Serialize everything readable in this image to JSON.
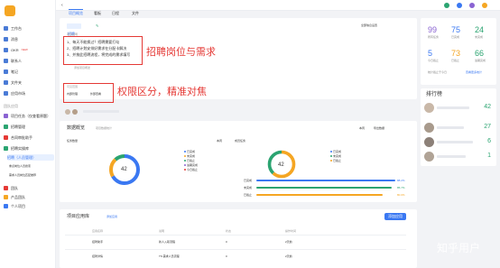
{
  "sidebar": {
    "items": [
      {
        "label": "工作台"
      },
      {
        "label": "消息"
      },
      {
        "label": "OKR",
        "badge": "NEW"
      },
      {
        "label": "联系人"
      },
      {
        "label": "笔记"
      },
      {
        "label": "文件夹"
      },
      {
        "label": "应用市场"
      }
    ],
    "section_label": "团队应用",
    "team_items": [
      {
        "label": "项目任务（仅查看原题）"
      },
      {
        "label": "招聘管理"
      },
      {
        "label": "合同审批助手"
      },
      {
        "label": "招聘实操库"
      }
    ],
    "sub_items": [
      {
        "label": "招聘（人员管理）"
      },
      {
        "label": "重点岗位人员搜索"
      },
      {
        "label": "需求人员岗位匹配推荐"
      }
    ],
    "bottom_items": [
      {
        "label": "团队"
      },
      {
        "label": "产品团队"
      },
      {
        "label": "个人项目"
      }
    ]
  },
  "topbar": {
    "tabs": [
      {
        "label": "项目概览"
      },
      {
        "label": "看板"
      },
      {
        "label": "日程"
      },
      {
        "label": "文件"
      }
    ],
    "icon_colors": [
      "#2ba471",
      "#3a78f2",
      "#8a63d2",
      "#f5a623"
    ]
  },
  "project": {
    "name": "招聘",
    "desc_header": "项目说明",
    "desc_lines": [
      "1、每天不能换过？招聘需要打勾",
      "2、招聘计划安排好需求在分配卡解决",
      "3、并按此招聘流程，将完成的需求填写"
    ],
    "extra_link": "添加项目概述",
    "link_label": "全部信息设置",
    "visibility_header": "可见范围",
    "visibility_options": [
      "内部",
      "外部"
    ],
    "visibility_values": [
      "内部管理",
      "外部查看"
    ]
  },
  "annotations": {
    "requirements": "招聘岗位与需求",
    "permissions": "权限区分，精准对焦"
  },
  "stats": [
    {
      "value": "99",
      "label": "所有任务",
      "color": "#8a63d2"
    },
    {
      "value": "75",
      "label": "已完成",
      "color": "#3a78f2"
    },
    {
      "value": "24",
      "label": "未完成",
      "color": "#2ba471"
    },
    {
      "value": "5",
      "label": "今日截止",
      "color": "#3a78f2"
    },
    {
      "value": "73",
      "label": "已截止",
      "color": "#f5a623"
    },
    {
      "value": "66",
      "label": "逾期完成",
      "color": "#2ba471"
    }
  ],
  "stats_note": "统计截止于今日",
  "stats_link": "查看更多统计",
  "ranking": {
    "title": "排行榜",
    "rows": [
      {
        "value": "42"
      },
      {
        "value": "27"
      },
      {
        "value": "6"
      },
      {
        "value": "1"
      }
    ]
  },
  "data_overview": {
    "title": "数据概览",
    "subtitle": "项目数据统计",
    "filter_label": "本周",
    "export_label": "导出数据",
    "left_chart": {
      "title": "任务数量",
      "center": "42",
      "filter": "本周",
      "legend": [
        "已完成",
        "未完成",
        "已截止",
        "逾期完成",
        "今日截止"
      ]
    },
    "right_chart": {
      "title": "成员任务",
      "center": "42",
      "legend": [
        "已完成",
        "未完成",
        "已截止"
      ]
    },
    "bars": [
      {
        "label": "已完成",
        "value": "88.2%",
        "color": "#3a78f2"
      },
      {
        "label": "未完成",
        "value": "85.7%",
        "color": "#2ba471"
      },
      {
        "label": "已截止",
        "value": "80.0%",
        "color": "#f5a623"
      }
    ]
  },
  "chart_data": [
    {
      "type": "pie",
      "title": "任务数量",
      "total": 42,
      "segments": [
        {
          "name": "已完成",
          "value": 28,
          "color": "#3a78f2"
        },
        {
          "name": "未完成",
          "value": 9,
          "color": "#f5a623"
        },
        {
          "name": "已截止",
          "value": 5,
          "color": "#2ba471"
        }
      ]
    },
    {
      "type": "pie",
      "title": "成员任务",
      "total": 42,
      "segments": [
        {
          "name": "已完成",
          "value": 26,
          "color": "#f5a623"
        },
        {
          "name": "未完成",
          "value": 16,
          "color": "#2ba471"
        }
      ]
    }
  ],
  "apps": {
    "title": "项目应用库",
    "link": "添加应用",
    "button": "添加应用",
    "columns": [
      "应用名称",
      "说明",
      "状态",
      "操作时间"
    ],
    "rows": [
      [
        "招聘助手",
        "新人入职流程",
        "0",
        "2天前"
      ],
      [
        "招聘详情",
        "TS 需求人员流程",
        "0",
        "2天前"
      ]
    ]
  },
  "watermark": "知乎用户"
}
